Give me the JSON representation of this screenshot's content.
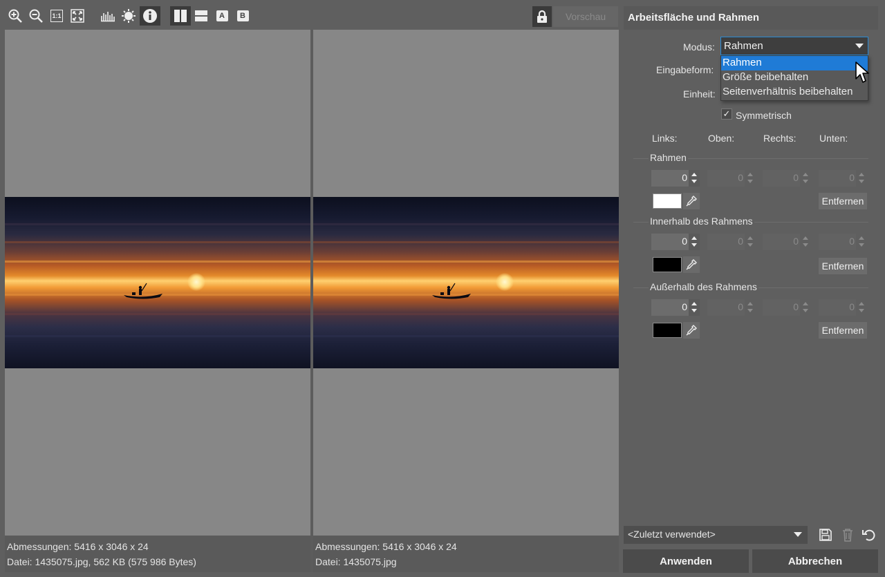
{
  "toolbar": {
    "zoom_in": "zoom-in",
    "zoom_out": "zoom-out",
    "actual_size_label": "1:1",
    "letter_a": "A",
    "letter_b": "B",
    "preview_label": "Vorschau"
  },
  "left_pane": {
    "dimensions": "Abmessungen: 5416 x 3046 x 24",
    "file": "Datei: 1435075.jpg, 562 KB (575 986 Bytes)"
  },
  "right_pane": {
    "dimensions": "Abmessungen: 5416 x 3046 x 24",
    "file": "Datei: 1435075.jpg"
  },
  "panel": {
    "title": "Arbeitsfläche und Rahmen",
    "modus_label": "Modus:",
    "modus_value": "Rahmen",
    "eingabeform_label": "Eingabeform:",
    "einheit_label": "Einheit:",
    "dropdown_options": [
      "Rahmen",
      "Größe beibehalten",
      "Seitenverhältnis beibehalten"
    ],
    "symmetrisch_label": "Symmetrisch",
    "symmetrisch_checked": true,
    "col_links": "Links:",
    "col_oben": "Oben:",
    "col_rechts": "Rechts:",
    "col_unten": "Unten:",
    "sections": [
      {
        "title": "Rahmen",
        "values": [
          "0",
          "0",
          "0",
          "0"
        ],
        "color": "#ffffff",
        "remove_label": "Entfernen"
      },
      {
        "title": "Innerhalb des Rahmens",
        "values": [
          "0",
          "0",
          "0",
          "0"
        ],
        "color": "#000000",
        "remove_label": "Entfernen"
      },
      {
        "title": "Außerhalb des Rahmens",
        "values": [
          "0",
          "0",
          "0",
          "0"
        ],
        "color": "#000000",
        "remove_label": "Entfernen"
      }
    ],
    "recent_label": "<Zuletzt verwendet>",
    "apply_label": "Anwenden",
    "cancel_label": "Abbrechen"
  }
}
